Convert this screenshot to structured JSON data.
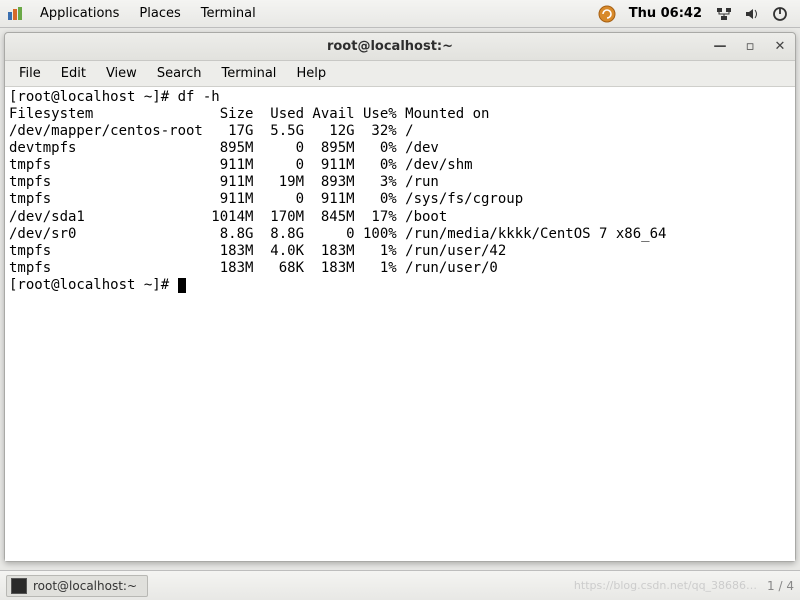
{
  "top_panel": {
    "applications": "Applications",
    "places": "Places",
    "terminal": "Terminal",
    "clock": "Thu 06:42"
  },
  "window": {
    "title": "root@localhost:~"
  },
  "menubar": {
    "file": "File",
    "edit": "Edit",
    "view": "View",
    "search": "Search",
    "terminal": "Terminal",
    "help": "Help"
  },
  "terminal": {
    "prompt1": "[root@localhost ~]# df -h",
    "header": "Filesystem               Size  Used Avail Use% Mounted on",
    "rows": [
      "/dev/mapper/centos-root   17G  5.5G   12G  32% /",
      "devtmpfs                 895M     0  895M   0% /dev",
      "tmpfs                    911M     0  911M   0% /dev/shm",
      "tmpfs                    911M   19M  893M   3% /run",
      "tmpfs                    911M     0  911M   0% /sys/fs/cgroup",
      "/dev/sda1               1014M  170M  845M  17% /boot",
      "/dev/sr0                 8.8G  8.8G     0 100% /run/media/kkkk/CentOS 7 x86_64",
      "tmpfs                    183M  4.0K  183M   1% /run/user/42",
      "tmpfs                    183M   68K  183M   1% /run/user/0"
    ],
    "prompt2": "[root@localhost ~]# "
  },
  "bottom_panel": {
    "task_label": "root@localhost:~",
    "watermark": "https://blog.csdn.net/qq_38686…",
    "pager": "1 / 4"
  }
}
